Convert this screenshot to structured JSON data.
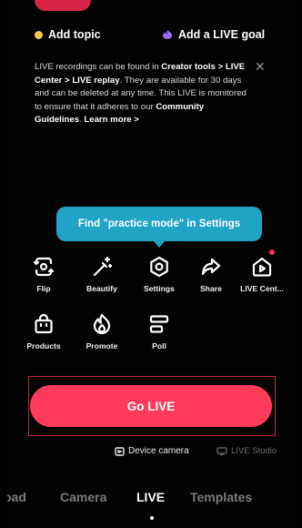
{
  "header": {
    "add_topic_label": "Add topic",
    "add_goal_label": "Add a LIVE goal"
  },
  "info": {
    "parts": [
      "LIVE recordings can be found in ",
      "Creator tools > LIVE Center > LIVE replay",
      ". They are available for 30 days and can be deleted at any time. This LIVE is monitored to ensure that it adheres to our ",
      "Community Guidelines",
      ". ",
      "Learn more >"
    ],
    "close_icon": "✕"
  },
  "tooltip": {
    "text": "Find \"practice mode\" in Settings"
  },
  "tools": [
    {
      "label": "Flip",
      "icon": "flip-camera-icon"
    },
    {
      "label": "Beautify",
      "icon": "magic-wand-icon"
    },
    {
      "label": "Settings",
      "icon": "gear-icon"
    },
    {
      "label": "Share",
      "icon": "share-arrow-icon"
    },
    {
      "label": "LIVE Cent...",
      "icon": "live-center-icon"
    },
    {
      "label": "Products",
      "icon": "shopping-bag-icon"
    },
    {
      "label": "Promote",
      "icon": "flame-icon"
    },
    {
      "label": "Poll",
      "icon": "poll-icon"
    }
  ],
  "primary": {
    "go_live_label": "Go LIVE",
    "device_camera_label": "Device camera",
    "live_studio_label": "LIVE Studio"
  },
  "mode_tabs": [
    {
      "label": "oad",
      "active": false
    },
    {
      "label": "Camera",
      "active": false
    },
    {
      "label": "LIVE",
      "active": true
    },
    {
      "label": "Templates",
      "active": false
    }
  ],
  "colors": {
    "accent": "#ff3b5c",
    "tooltip": "#20a3c4",
    "topic_dot": "#f6c94b"
  }
}
